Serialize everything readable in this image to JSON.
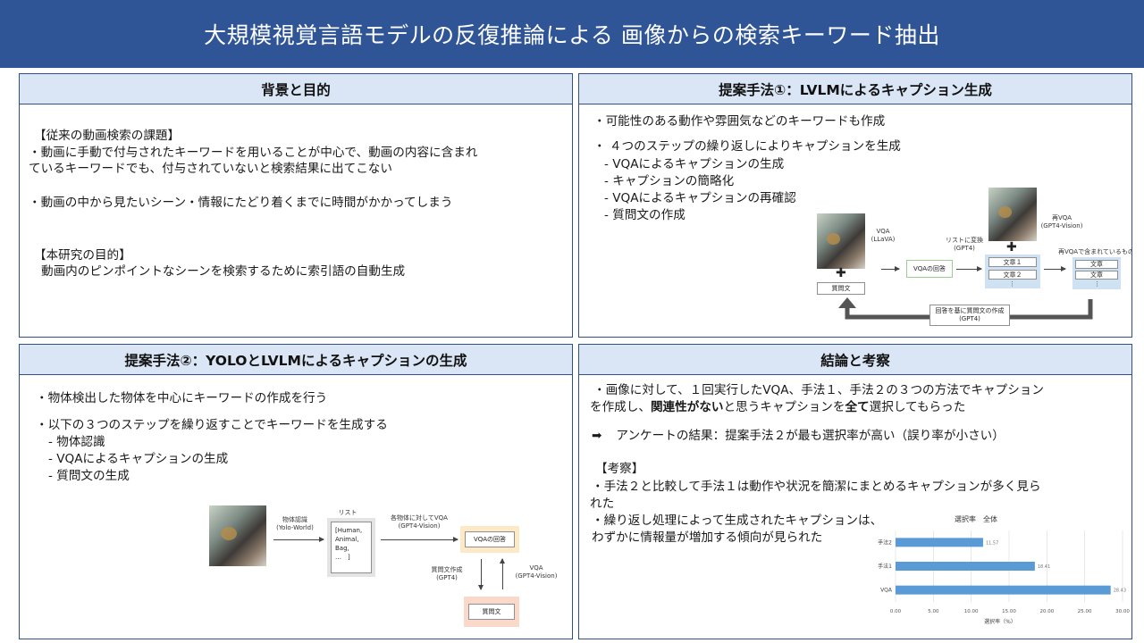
{
  "header": {
    "title": "大規模視覚言語モデルの反復推論による 画像からの検索キーワード抽出"
  },
  "panel1": {
    "heading": "背景と目的",
    "issue_title": "【従来の動画検索の課題】",
    "issue_line1": "・動画に手動で付与されたキーワードを用いることが中心で、動画の内容に含まれ",
    "issue_line2": "ているキーワードでも、付与されていないと検索結果に出てこない",
    "issue_line3": "・動画の中から見たいシーン・情報にたどり着くまでに時間がかかってしまう",
    "purpose_title": "【本研究の目的】",
    "purpose_line": "動画内のピンポイントなシーンを検索するために索引語の自動生成"
  },
  "panel2": {
    "heading": "提案手法①：LVLMによるキャプション生成",
    "bullet1": "・可能性のある動作や雰囲気などのキーワードも作成",
    "bullet2": "・ ４つのステップの繰り返しによりキャプションを生成",
    "steps": [
      "- VQAによるキャプションの生成",
      "- キャプションの簡略化",
      "- VQAによるキャプションの再確認",
      "- 質問文の作成"
    ],
    "diagram": {
      "vqa_label": "VQA\n(LLaVA)",
      "question": "質問文",
      "vqa_answer": "VQAの回答",
      "list_convert": "リストに変換\n(GPT4)",
      "sentence1": "文章１",
      "sentence2": "文章２",
      "ellipsis": "⋮",
      "revqa": "再VQA\n(GPT4-Vision)",
      "revqa_contained": "再VQAで含まれているもの",
      "s1": "文章",
      "s2": "文章",
      "loop": "回答を基に質問文の作成\n(GPT4)"
    }
  },
  "panel3": {
    "heading": "提案手法②：YOLOとLVLMによるキャプションの生成",
    "bullet1": "・物体検出した物体を中心にキーワードの作成を行う",
    "bullet2": "・以下の３つのステップを繰り返すことでキーワードを生成する",
    "steps": [
      "- 物体認識",
      "- VQAによるキャプションの生成",
      "- 質問文の生成"
    ],
    "diagram": {
      "object_rec": "物体認識\n(Yolo-World)",
      "list_title": "リスト",
      "list_content": "[Human,\nAnimal,\nBag,\n…　]",
      "per_object": "各物体に対してVQA\n(GPT4-Vision)",
      "vqa_answer": "VQAの回答",
      "question_gen": "質問文作成\n(GPT4)",
      "vqa2": "VQA\n(GPT4-Vision)",
      "question": "質問文"
    }
  },
  "panel4": {
    "heading": "結論と考察",
    "line1": "・画像に対して、１回実行したVQA、手法１、手法２の３つの方法でキャプション",
    "line2_pre": "を作成し、",
    "line2_b1": "関連性がない",
    "line2_mid": "と思うキャプションを",
    "line2_b2": "全て",
    "line2_post": "選択してもらった",
    "arrow": "➡",
    "result": "アンケートの結果：提案手法２が最も選択率が高い（誤り率が小さい）",
    "discussion_title": "【考察】",
    "disc1": "・手法２と比較して手法１は動作や状況を簡潔にまとめるキャプションが多く見ら",
    "disc2": "れた",
    "disc3": "・繰り返し処理によって生成されたキャプションは、",
    "disc4": "わずかに情報量が増加する傾向が見られた"
  },
  "chart_data": {
    "type": "bar",
    "orientation": "horizontal",
    "title": "選択率　全体",
    "xlabel": "選択率（%）",
    "ylabel": "",
    "categories": [
      "手法2",
      "手法1",
      "VQA"
    ],
    "values": [
      11.57,
      18.41,
      28.43
    ],
    "xlim": [
      0,
      30
    ],
    "xticks": [
      "0.00",
      "5.00",
      "10.00",
      "15.00",
      "20.00",
      "25.00",
      "30.00"
    ],
    "bar_color": "#5b9bd5",
    "grid": true
  }
}
